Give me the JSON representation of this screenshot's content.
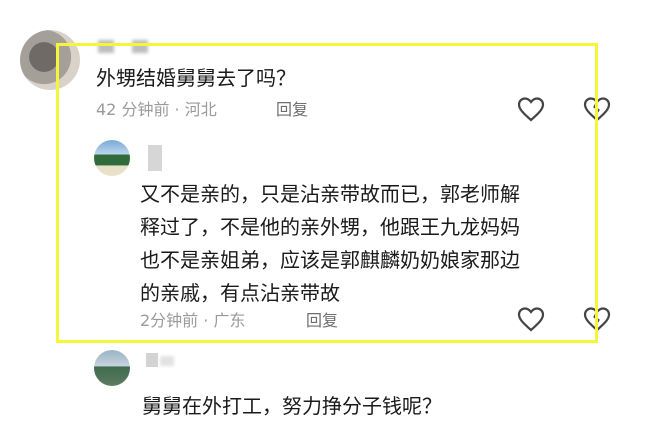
{
  "comments": [
    {
      "text": "外甥结婚舅舅去了吗？",
      "meta": "42 分钟前 · 河北",
      "reply_label": "回复"
    },
    {
      "text": "又不是亲的，只是沾亲带故而已，郭老师解\n释过了，不是他的亲外甥，他跟王九龙妈妈\n也不是亲姐弟，应该是郭麒麟奶奶娘家那边\n的亲戚，有点沾亲带故",
      "meta": "2分钟前 · 广东",
      "reply_label": "回复"
    },
    {
      "text": "舅舅在外打工，努力挣分子钱呢？"
    }
  ],
  "icons": {
    "like": "heart-outline-icon",
    "dislike": "heart-broken-outline-icon"
  },
  "colors": {
    "highlight": "#f5f53a",
    "text": "#1a1a1a",
    "meta": "#9a9a9a"
  }
}
